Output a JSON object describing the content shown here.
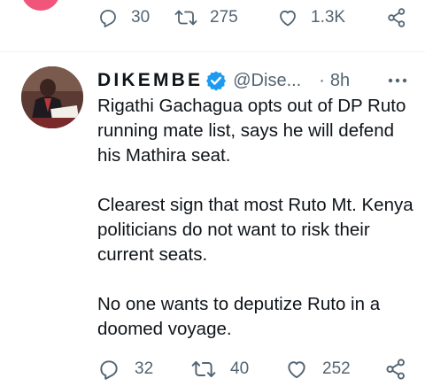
{
  "previous_tweet": {
    "actions": {
      "replies": "30",
      "retweets": "275",
      "likes": "1.3K"
    },
    "avatar_color": "#f0567a"
  },
  "tweet": {
    "display_name": "DIKEMBE",
    "handle": "@Dise...",
    "separator": "·",
    "time": "8h",
    "verified": true,
    "verified_color": "#1d9bf0",
    "paragraphs": [
      "Rigathi Gachagua opts out of DP Ruto running mate list, says he will defend his Mathira seat.",
      "Clearest sign that most Ruto Mt. Kenya politicians do not want to risk their current seats.",
      "No one wants to deputize Ruto in a doomed voyage."
    ],
    "actions": {
      "replies": "32",
      "retweets": "40",
      "likes": "252"
    }
  },
  "colors": {
    "text": "#0f1419",
    "secondary": "#536471",
    "divider": "#eff3f4"
  }
}
